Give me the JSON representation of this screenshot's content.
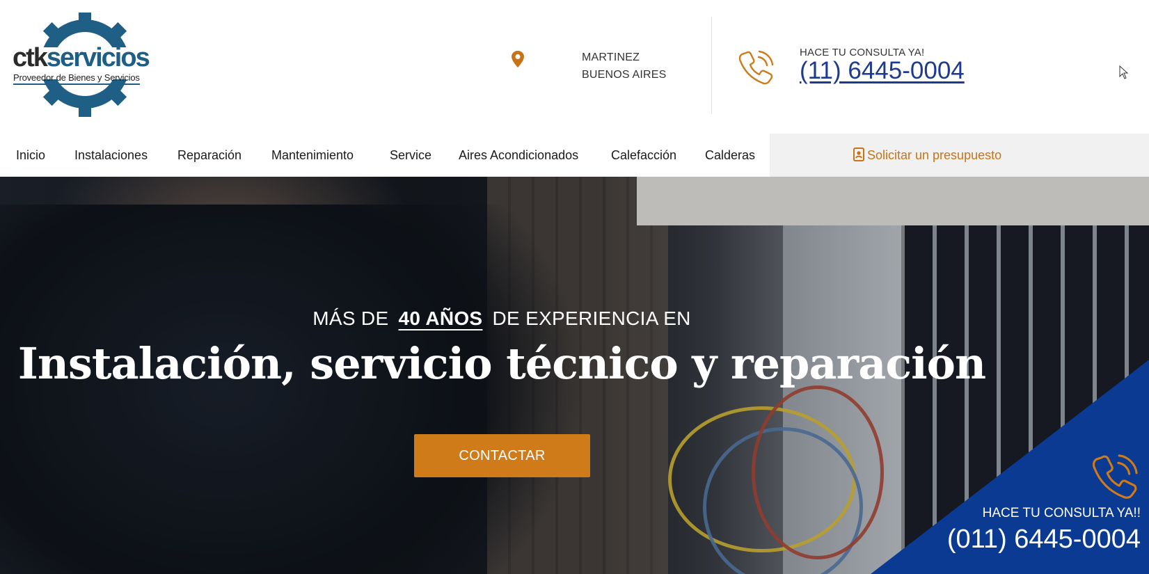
{
  "header": {
    "logo": {
      "brand_text": "ctkservicios",
      "tagline": "Proveedor de Bienes y Servicios",
      "icon": "gear-logo-icon"
    },
    "location": {
      "icon": "map-pin-icon",
      "line1": "MARTINEZ",
      "line2": "BUENOS AIRES"
    },
    "contact": {
      "icon": "phone-icon",
      "label": "HACE TU CONSULTA YA!",
      "phone": "(11) 6445-0004"
    }
  },
  "nav": {
    "items": [
      {
        "label": "Inicio"
      },
      {
        "label": "Instalaciones"
      },
      {
        "label": "Reparación"
      },
      {
        "label": "Mantenimiento"
      },
      {
        "label": "Service"
      },
      {
        "label": "Aires Acondicionados"
      },
      {
        "label": "Calefacción"
      },
      {
        "label": "Calderas"
      }
    ],
    "quote": {
      "label": "Solicitar un presupuesto",
      "icon": "contact-card-icon"
    }
  },
  "hero": {
    "sub_prefix": "MÁS DE",
    "sub_highlight": "40 AÑOS",
    "sub_suffix": "DE EXPERIENCIA EN",
    "title": "Instalación, servicio técnico y reparación",
    "cta_label": "CONTACTAR"
  },
  "corner_callout": {
    "icon": "phone-icon",
    "label": "HACE TU CONSULTA YA!!",
    "phone": "(011) 6445-0004"
  },
  "colors": {
    "accent_orange": "#d07b1a",
    "brand_blue": "#1d3a8f",
    "callout_blue": "#0b3a93",
    "logo_blue": "#1f5f86"
  }
}
